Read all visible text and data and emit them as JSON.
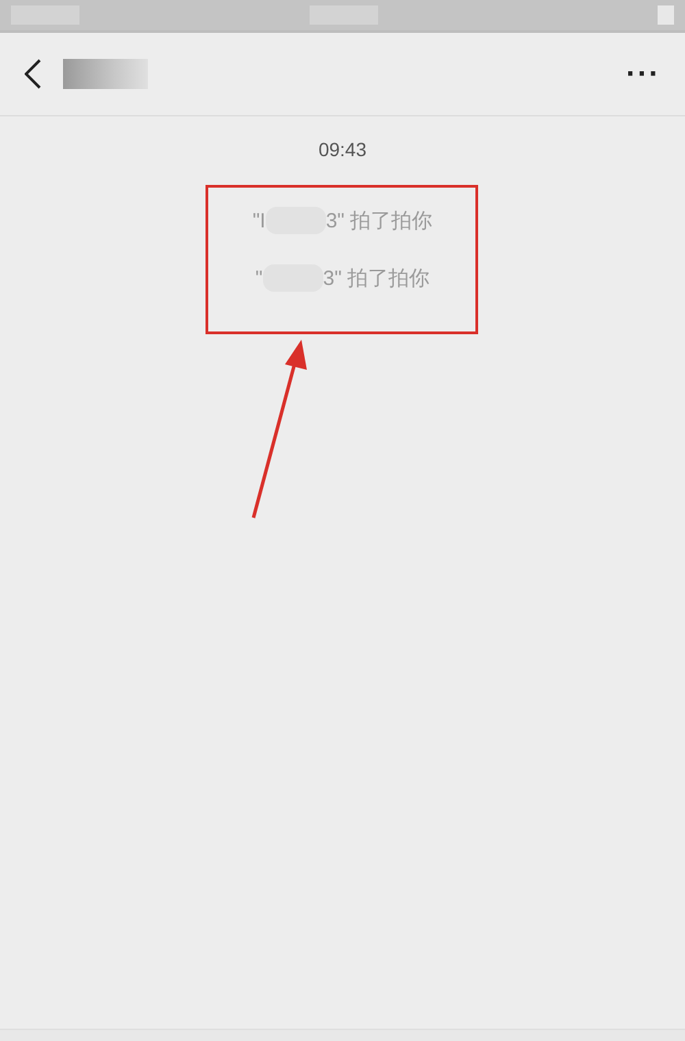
{
  "header": {
    "more": "···"
  },
  "time": "09:43",
  "notices": [
    {
      "before": "\"I",
      "after": "3\" 拍了拍你"
    },
    {
      "before": "\"",
      "after": "3\" 拍了拍你"
    }
  ],
  "annotation": {
    "color": "#d9302a"
  }
}
